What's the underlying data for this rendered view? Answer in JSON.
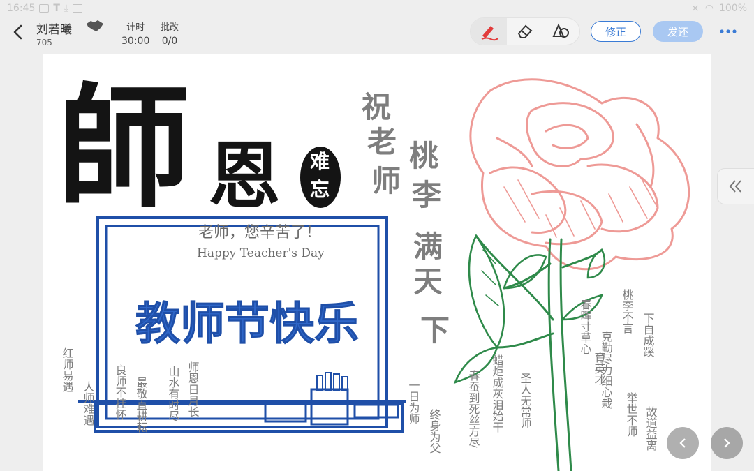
{
  "status_bar": {
    "time": "16:45",
    "battery": "100%"
  },
  "header": {
    "student_name": "刘若曦",
    "student_id": "705",
    "timer_label": "计时",
    "timer_value": "30:00",
    "grading_label": "批改",
    "grading_value": "0/0"
  },
  "toolbar": {
    "tools": [
      "pen-icon",
      "eraser-icon",
      "shapes-icon"
    ],
    "active_tool": "pen-icon",
    "revise_label": "修正",
    "return_label": "发还",
    "accent": "#3a7bd5"
  },
  "artwork": {
    "title_big": "師",
    "title_second": "恩",
    "badge_top": "难",
    "badge_bottom": "忘",
    "board_line1": "老师，您辛苦了！",
    "board_line2": "Happy Teacher's Day",
    "board_main": "教师节快乐",
    "vertical_zhu": [
      "祝",
      "老",
      "师"
    ],
    "vertical_taoli": [
      "桃",
      "李",
      "满",
      "天",
      "下"
    ],
    "left_phrases": [
      "红师易遇",
      "人师难遇",
      "良师不挂怀",
      "最敬直耕耘",
      "山水有时尽",
      "师恩日月长"
    ],
    "middle_phrases": [
      "一日为师",
      "终身为父",
      "春蚕到死丝方尽",
      "蜡炬成灰泪始干"
    ],
    "right_phrases": [
      "圣人无常师",
      "春晖寸草心",
      "育英才",
      "克勤尽力细心栽",
      "桃李不言",
      "下自成蹊",
      "举世不师",
      "故道益离"
    ],
    "colors": {
      "blue": "#1f4fa8",
      "rose": "#ee9a96",
      "stem": "#2f8a4a",
      "ink": "#141414",
      "gray": "#7e7e7e"
    }
  }
}
